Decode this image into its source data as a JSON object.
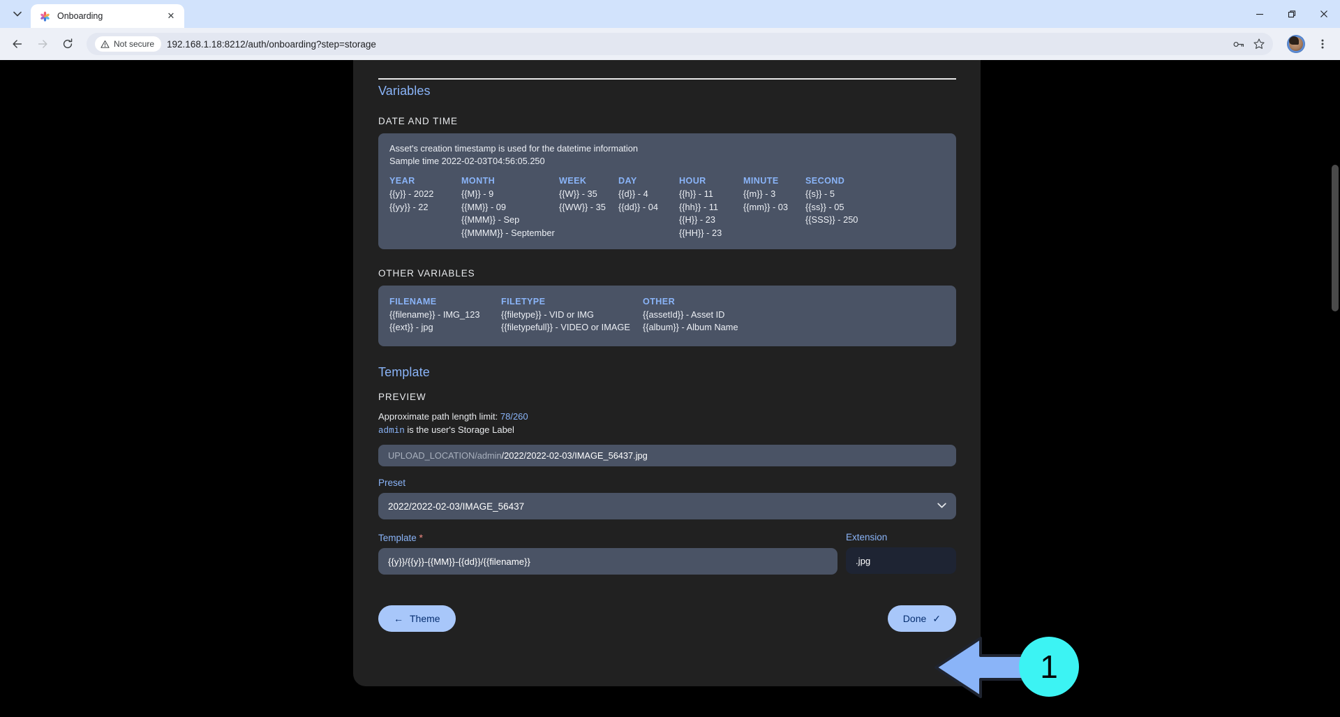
{
  "browser": {
    "tab": {
      "title": "Onboarding",
      "favicon": "immich-logo-icon",
      "close": "✕"
    },
    "window_controls": {
      "minimize": "—",
      "maximize": "❐",
      "close": "✕"
    },
    "nav": {
      "back": "←",
      "forward": "→",
      "reload": "↻"
    },
    "omnibox": {
      "security_label": "Not secure",
      "url": "192.168.1.18:8212/auth/onboarding?step=storage",
      "icons": [
        "key-icon",
        "bookmark-star-icon"
      ]
    },
    "profile": "avatar",
    "menu": "⋮"
  },
  "page": {
    "variables": {
      "title": "Variables",
      "date_and_time": {
        "label": "DATE AND TIME",
        "note_line1": "Asset's creation timestamp is used for the datetime information",
        "note_line2": "Sample time 2022-02-03T04:56:05.250",
        "columns": [
          {
            "head": "YEAR",
            "rows": [
              "{{y}} - 2022",
              "{{yy}} - 22"
            ]
          },
          {
            "head": "MONTH",
            "rows": [
              "{{M}} - 9",
              "{{MM}} - 09",
              "{{MMM}} - Sep",
              "{{MMMM}} - September"
            ]
          },
          {
            "head": "WEEK",
            "rows": [
              "{{W}} - 35",
              "{{WW}} - 35"
            ]
          },
          {
            "head": "DAY",
            "rows": [
              "{{d}} - 4",
              "{{dd}} - 04"
            ]
          },
          {
            "head": "HOUR",
            "rows": [
              "{{h}} - 11",
              "{{hh}} - 11",
              "{{H}} - 23",
              "{{HH}} - 23"
            ]
          },
          {
            "head": "MINUTE",
            "rows": [
              "{{m}} - 3",
              "{{mm}} - 03"
            ]
          },
          {
            "head": "SECOND",
            "rows": [
              "{{s}} - 5",
              "{{ss}} - 05",
              "{{SSS}} - 250"
            ]
          }
        ]
      },
      "other_variables": {
        "label": "OTHER VARIABLES",
        "columns": [
          {
            "head": "FILENAME",
            "rows": [
              "{{filename}} - IMG_123",
              "{{ext}} - jpg"
            ]
          },
          {
            "head": "FILETYPE",
            "rows": [
              "{{filetype}} - VID or IMG",
              "{{filetypefull}} - VIDEO or IMAGE"
            ]
          },
          {
            "head": "OTHER",
            "rows": [
              "{{assetId}} - Asset ID",
              "{{album}} - Album Name"
            ]
          }
        ]
      }
    },
    "template": {
      "title": "Template",
      "preview_label": "PREVIEW",
      "path_limit_prefix": "Approximate path length limit: ",
      "path_limit_value": "78/260",
      "storage_label_code": "admin",
      "storage_label_text": " is the user's Storage Label",
      "preview_path_dim": "UPLOAD_LOCATION/admin",
      "preview_path_bright": "/2022/2022-02-03/IMAGE_56437.jpg",
      "preset_label": "Preset",
      "preset_value": "2022/2022-02-03/IMAGE_56437",
      "preset_options": [
        "2022/2022-02-03/IMAGE_56437"
      ],
      "template_label": "Template",
      "template_required_mark": "*",
      "template_value": "{{y}}/{{y}}-{{MM}}-{{dd}}/{{filename}}",
      "extension_label": "Extension",
      "extension_value": ".jpg"
    },
    "footer": {
      "back_button": "Theme",
      "back_arrow": "←",
      "done_button": "Done",
      "done_check": "✓"
    }
  },
  "annotation": {
    "step_number": "1",
    "circle_color": "#3cf3f3",
    "arrow_color": "#8ab4f8",
    "arrow_direction": "left"
  },
  "colors": {
    "accent_blue": "#8ab4f8",
    "panel_bg": "#4a5365",
    "card_bg": "#212121",
    "button_bg": "#a8c7fa",
    "required_red": "#f28b82"
  }
}
